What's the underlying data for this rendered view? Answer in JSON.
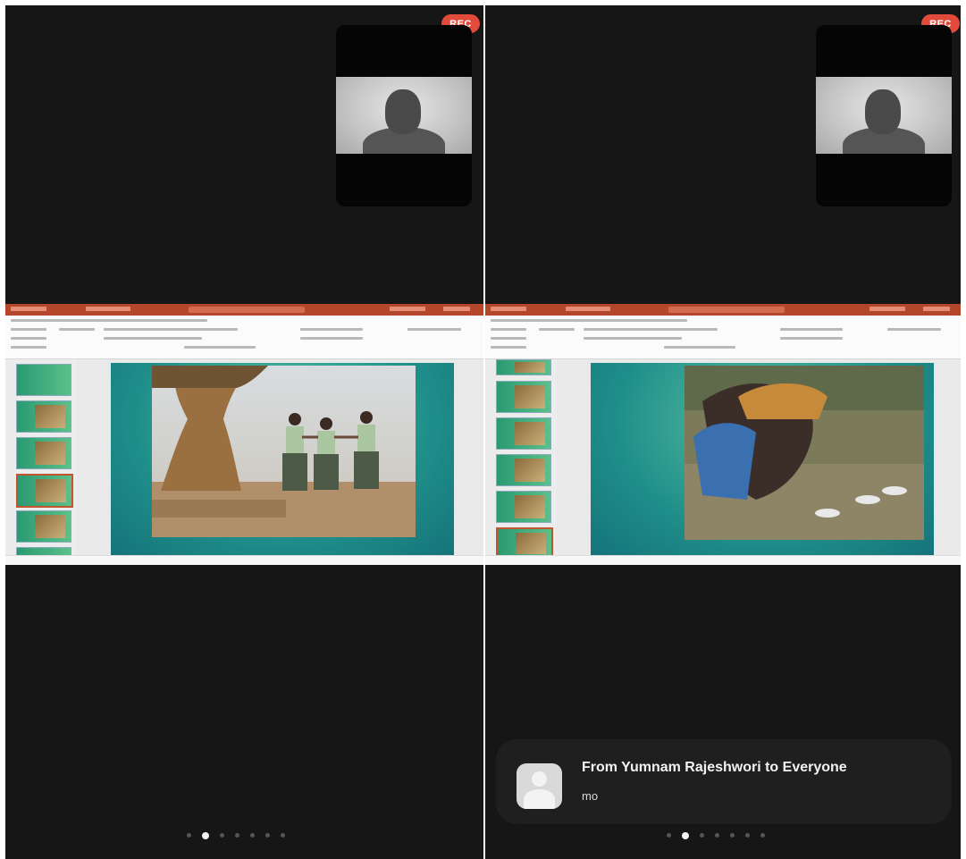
{
  "panels": [
    {
      "rec_label": "REC",
      "active_page": 1,
      "page_count": 7
    },
    {
      "rec_label": "REC",
      "active_page": 1,
      "page_count": 7,
      "chat_notification": {
        "title": "From Yumnam Rajeshwori to Everyone",
        "message": "mo",
        "avatar_icon": "user-avatar-icon"
      }
    }
  ],
  "colors": {
    "background": "#161616",
    "rec_badge": "#e24a3b",
    "powerpoint_titlebar": "#b4472a",
    "slide_gradient": "#1f8f8a",
    "chat_toast": "#1f1f1f"
  }
}
